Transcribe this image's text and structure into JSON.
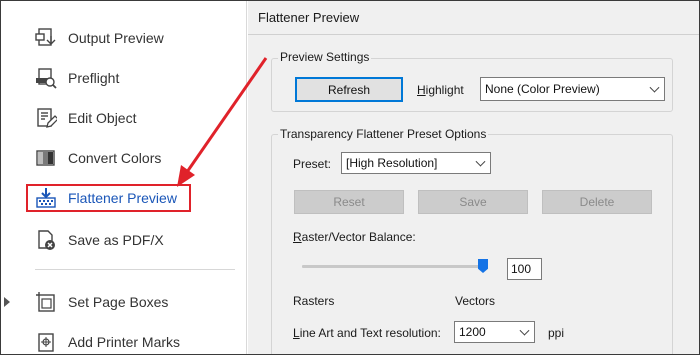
{
  "tools": {
    "items": [
      {
        "label": "Output Preview",
        "icon": "output-preview-icon"
      },
      {
        "label": "Preflight",
        "icon": "preflight-icon"
      },
      {
        "label": "Edit Object",
        "icon": "edit-object-icon"
      },
      {
        "label": "Convert Colors",
        "icon": "convert-colors-icon"
      },
      {
        "label": "Flattener Preview",
        "icon": "flattener-preview-icon"
      },
      {
        "label": "Save as PDF/X",
        "icon": "save-pdfx-icon"
      },
      {
        "label": "Set Page Boxes",
        "icon": "set-page-boxes-icon"
      },
      {
        "label": "Add Printer Marks",
        "icon": "add-printer-marks-icon"
      }
    ],
    "active_item": "Flattener Preview"
  },
  "panel": {
    "title": "Flattener Preview",
    "preview_settings": {
      "title": "Preview Settings",
      "refresh_label": "Refresh",
      "highlight_label": "Highlight",
      "highlight_value": "None (Color Preview)"
    },
    "preset_options": {
      "title": "Transparency Flattener Preset Options",
      "preset_label": "Preset:",
      "preset_value": "[High Resolution]",
      "reset_label": "Reset",
      "save_label": "Save",
      "delete_label": "Delete",
      "balance_label": "Raster/Vector Balance:",
      "balance_value": "100",
      "rasters_label": "Rasters",
      "vectors_label": "Vectors",
      "line_art_label": "Line Art and Text resolution:",
      "line_art_value": "1200",
      "line_art_unit": "ppi"
    }
  },
  "colors": {
    "annotation_red": "#e0222a",
    "active_blue": "#1a56b8",
    "slider_blue": "#1473e6"
  }
}
